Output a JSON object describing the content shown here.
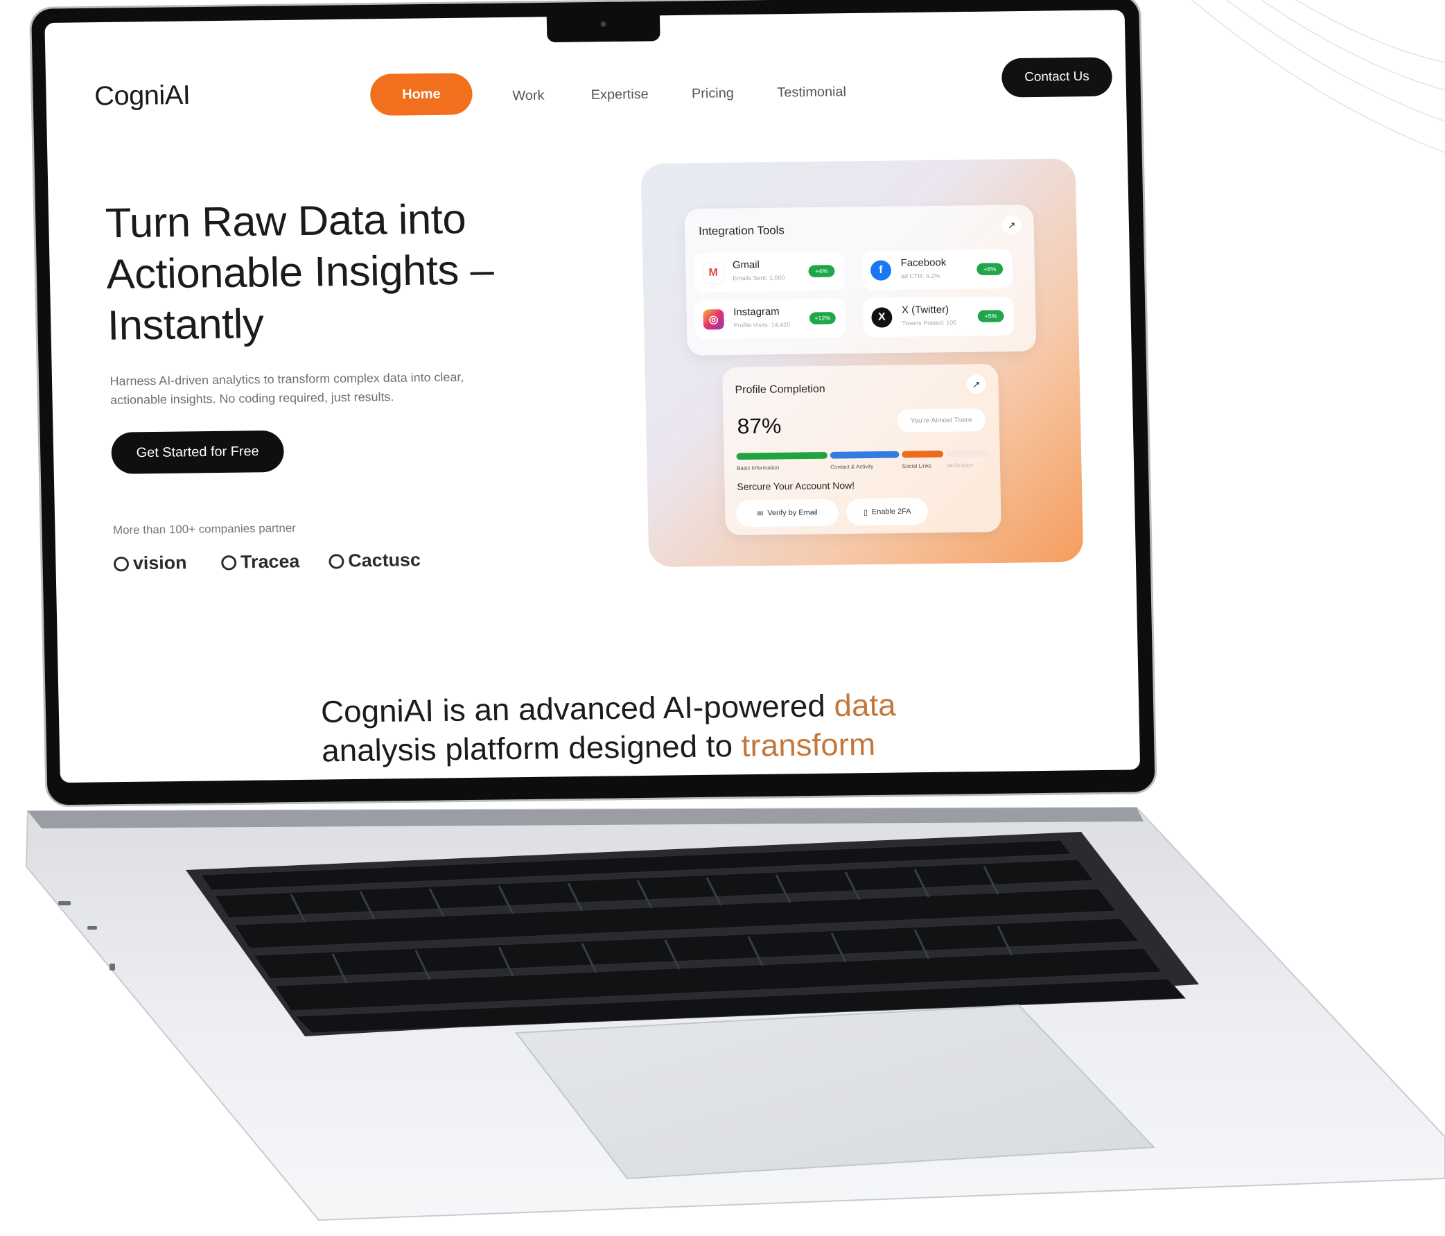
{
  "nav": {
    "logo": "CogniAI",
    "items": [
      "Home",
      "Work",
      "Expertise",
      "Pricing",
      "Testimonial"
    ],
    "contact": "Contact Us"
  },
  "hero": {
    "title": "Turn Raw Data into Actionable Insights – Instantly",
    "subtitle": "Harness AI-driven analytics to transform complex data into clear, actionable insights. No coding required, just results.",
    "cta": "Get Started for Free",
    "partners_label": "More than 100+ companies partner",
    "partners": [
      "vision",
      "Tracea",
      "Cactusc"
    ]
  },
  "dashboard": {
    "integration": {
      "title": "Integration Tools",
      "arrow": "↗",
      "tools": [
        {
          "name": "Gmail",
          "icon": "gmail-icon",
          "glyph": "M",
          "sub": "Emails Sent: 1,000",
          "badge": "+4%"
        },
        {
          "name": "Facebook",
          "icon": "facebook-icon",
          "glyph": "f",
          "sub": "ad CTR: 4.2%",
          "badge": "+6%"
        },
        {
          "name": "Instagram",
          "icon": "instagram-icon",
          "glyph": "◎",
          "sub": "Profile Visits: 14,420",
          "badge": "+12%"
        },
        {
          "name": "X (Twitter)",
          "icon": "x-twitter-icon",
          "glyph": "X",
          "sub": "Tweets Posted: 105",
          "badge": "+5%"
        }
      ]
    },
    "profile": {
      "title": "Profile Completion",
      "arrow": "↗",
      "percent": "87%",
      "almost": "You're Almost There",
      "segments": [
        {
          "label": "Basic Information",
          "color": "#22a33f"
        },
        {
          "label": "Contact & Activity",
          "color": "#2f7de1"
        },
        {
          "label": "Social Links",
          "color": "#ee6a1c"
        },
        {
          "label": "Verification",
          "color": "#f3e9e2"
        }
      ],
      "secure": "Sercure Your Account Now!",
      "buttons": [
        "Verify by Email",
        "Enable 2FA"
      ]
    }
  },
  "statement": {
    "part1": "CogniAI is an advanced AI-powered ",
    "hl1": "data",
    "part2": "analysis platform designed to ",
    "hl2": "transform"
  },
  "colors": {
    "accent": "#f26f1d",
    "dark": "#0f0f0f",
    "highlight": "#c4773b"
  }
}
